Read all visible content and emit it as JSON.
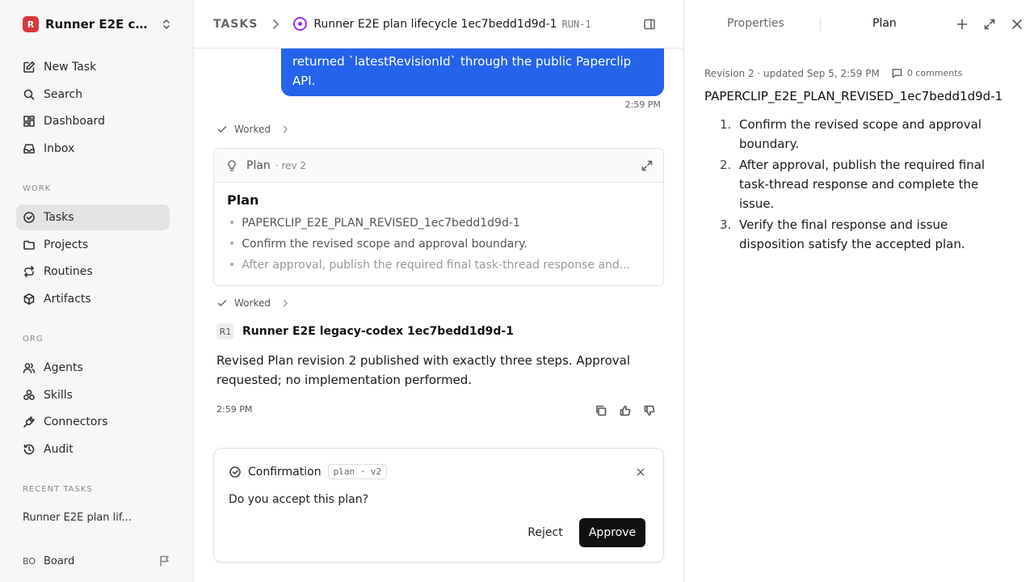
{
  "sidebar": {
    "workspace": {
      "logo": "R",
      "name": "Runner E2E co..."
    },
    "nav": [
      {
        "label": "New Task",
        "icon": "pencil-square-icon"
      },
      {
        "label": "Search",
        "icon": "search-icon"
      },
      {
        "label": "Dashboard",
        "icon": "dashboard-icon"
      },
      {
        "label": "Inbox",
        "icon": "inbox-icon"
      }
    ],
    "work_label": "WORK",
    "work": [
      {
        "label": "Tasks",
        "icon": "check-circle-icon",
        "active": true
      },
      {
        "label": "Projects",
        "icon": "folder-icon"
      },
      {
        "label": "Routines",
        "icon": "repeat-icon"
      },
      {
        "label": "Artifacts",
        "icon": "box-icon"
      }
    ],
    "org_label": "ORG",
    "org": [
      {
        "label": "Agents",
        "icon": "users-icon"
      },
      {
        "label": "Skills",
        "icon": "skills-icon"
      },
      {
        "label": "Connectors",
        "icon": "plug-icon"
      },
      {
        "label": "Audit",
        "icon": "history-icon"
      }
    ],
    "recent_label": "RECENT TASKS",
    "recent": [
      "Runner E2E plan lif..."
    ],
    "user": {
      "initials": "BO",
      "label": "Board"
    }
  },
  "header": {
    "section": "TASKS",
    "title": "Runner E2E plan lifecycle 1ec7bedd1d9d-1",
    "run_id": "RUN-1",
    "status_color": "#9333ea"
  },
  "thread": {
    "user_message": "returned `latestRevisionId` through the public Paperclip API.",
    "user_time": "2:59 PM",
    "worked_label": "Worked",
    "plan_card": {
      "name": "Plan",
      "rev": "· rev 2",
      "heading": "Plan",
      "items": [
        "PAPERCLIP_E2E_PLAN_REVISED_1ec7bedd1d9d-1",
        "Confirm the revised scope and approval boundary.",
        "After approval, publish the required final task-thread response and..."
      ]
    },
    "agent": {
      "avatar": "R1",
      "name": "Runner E2E legacy-codex 1ec7bedd1d9d-1",
      "message": "Revised Plan revision 2 published with exactly three steps. Approval requested; no implementation performed.",
      "time": "2:59 PM"
    }
  },
  "confirmation": {
    "title": "Confirmation",
    "tag": "plan · v2",
    "question": "Do you accept this plan?",
    "reject_label": "Reject",
    "approve_label": "Approve"
  },
  "panel": {
    "tabs": {
      "properties": "Properties",
      "plan": "Plan"
    },
    "meta": "Revision 2 · updated Sep 5, 2:59 PM",
    "comments": "0 comments",
    "title": "PAPERCLIP_E2E_PLAN_REVISED_1ec7bedd1d9d-1",
    "steps": [
      {
        "n": "1.",
        "text": "Confirm the revised scope and approval boundary."
      },
      {
        "n": "2.",
        "text": "After approval, publish the required final task-thread response and complete the issue."
      },
      {
        "n": "3.",
        "text": "Verify the final response and issue disposition satisfy the accepted plan."
      }
    ]
  },
  "colors": {
    "accent": "#2563eb",
    "approve": "#111111",
    "status": "#9333ea",
    "logo": "#d83a3a"
  }
}
